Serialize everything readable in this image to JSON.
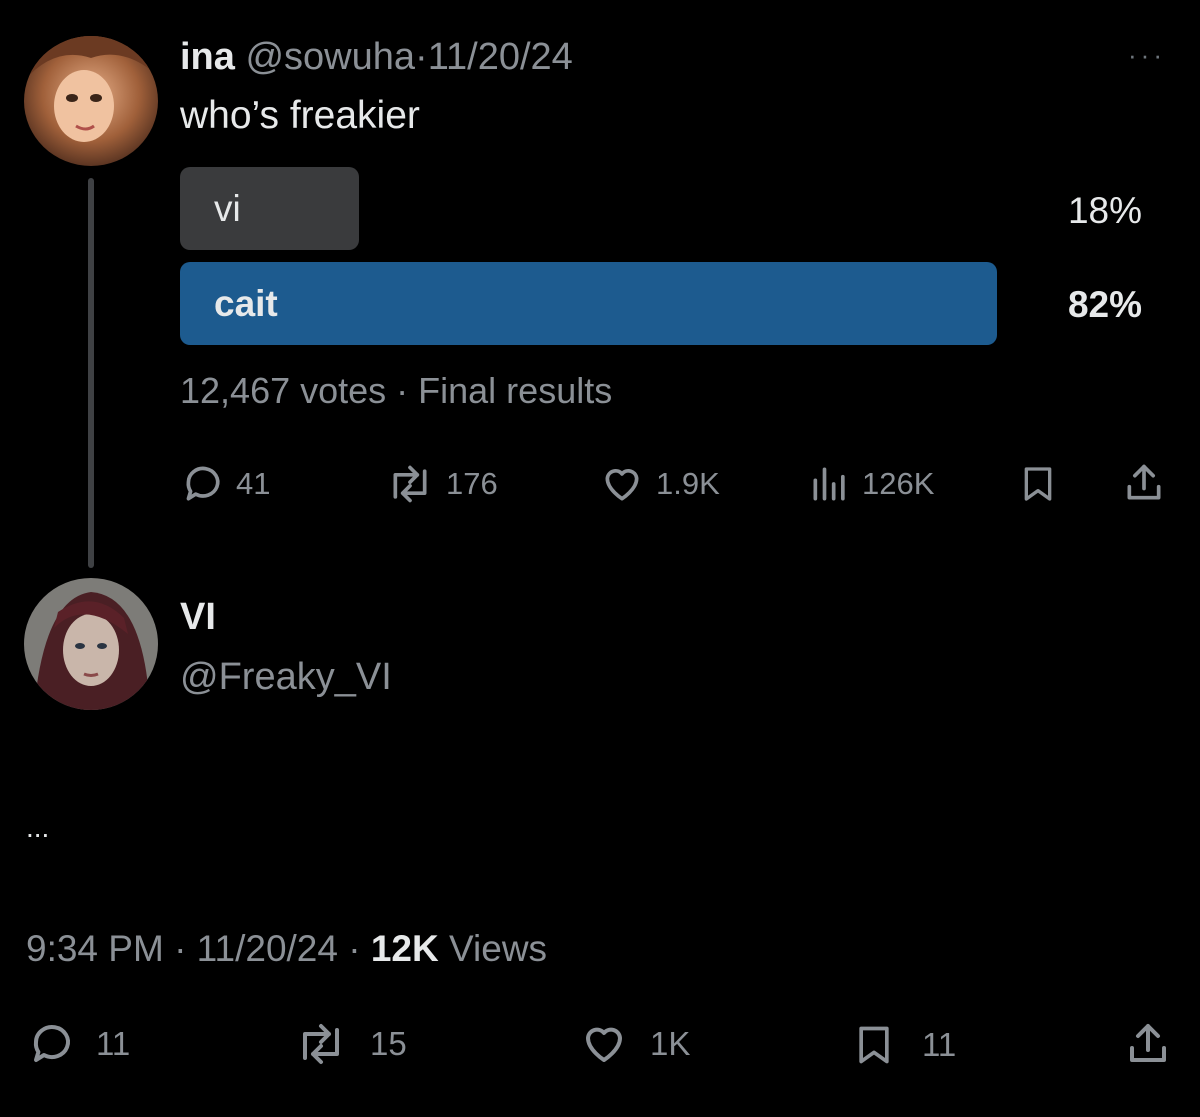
{
  "quoted_post": {
    "display_name": "ina",
    "handle": "@sowuha",
    "separator": "·",
    "date": "11/20/24",
    "text": "who’s freakier",
    "more_label": "···",
    "poll": {
      "options": [
        {
          "label": "vi",
          "percent_text": "18%",
          "percent": 18,
          "winner": false
        },
        {
          "label": "cait",
          "percent_text": "82%",
          "percent": 82,
          "winner": true
        }
      ],
      "summary": "12,467 votes · Final results"
    },
    "actions": {
      "replies": "41",
      "reposts": "176",
      "likes": "1.9K",
      "views": "126K"
    }
  },
  "reply_post": {
    "display_name": "VI",
    "handle": "@Freaky_VI",
    "body_text": "...",
    "timestamp": "9:34 PM · 11/20/24 · ",
    "views_count": "12K",
    "views_label": " Views",
    "actions": {
      "replies": "11",
      "reposts": "15",
      "likes": "1K",
      "bookmarks": "11"
    }
  },
  "colors": {
    "background": "#000000",
    "poll_winner": "#1d5b8f",
    "poll_loser": "#3a3b3d",
    "muted_text": "#8b9096",
    "thread_line": "#3f4144"
  },
  "icons": [
    "reply-icon",
    "repost-icon",
    "like-icon",
    "views-icon",
    "bookmark-icon",
    "share-icon",
    "more-icon"
  ]
}
